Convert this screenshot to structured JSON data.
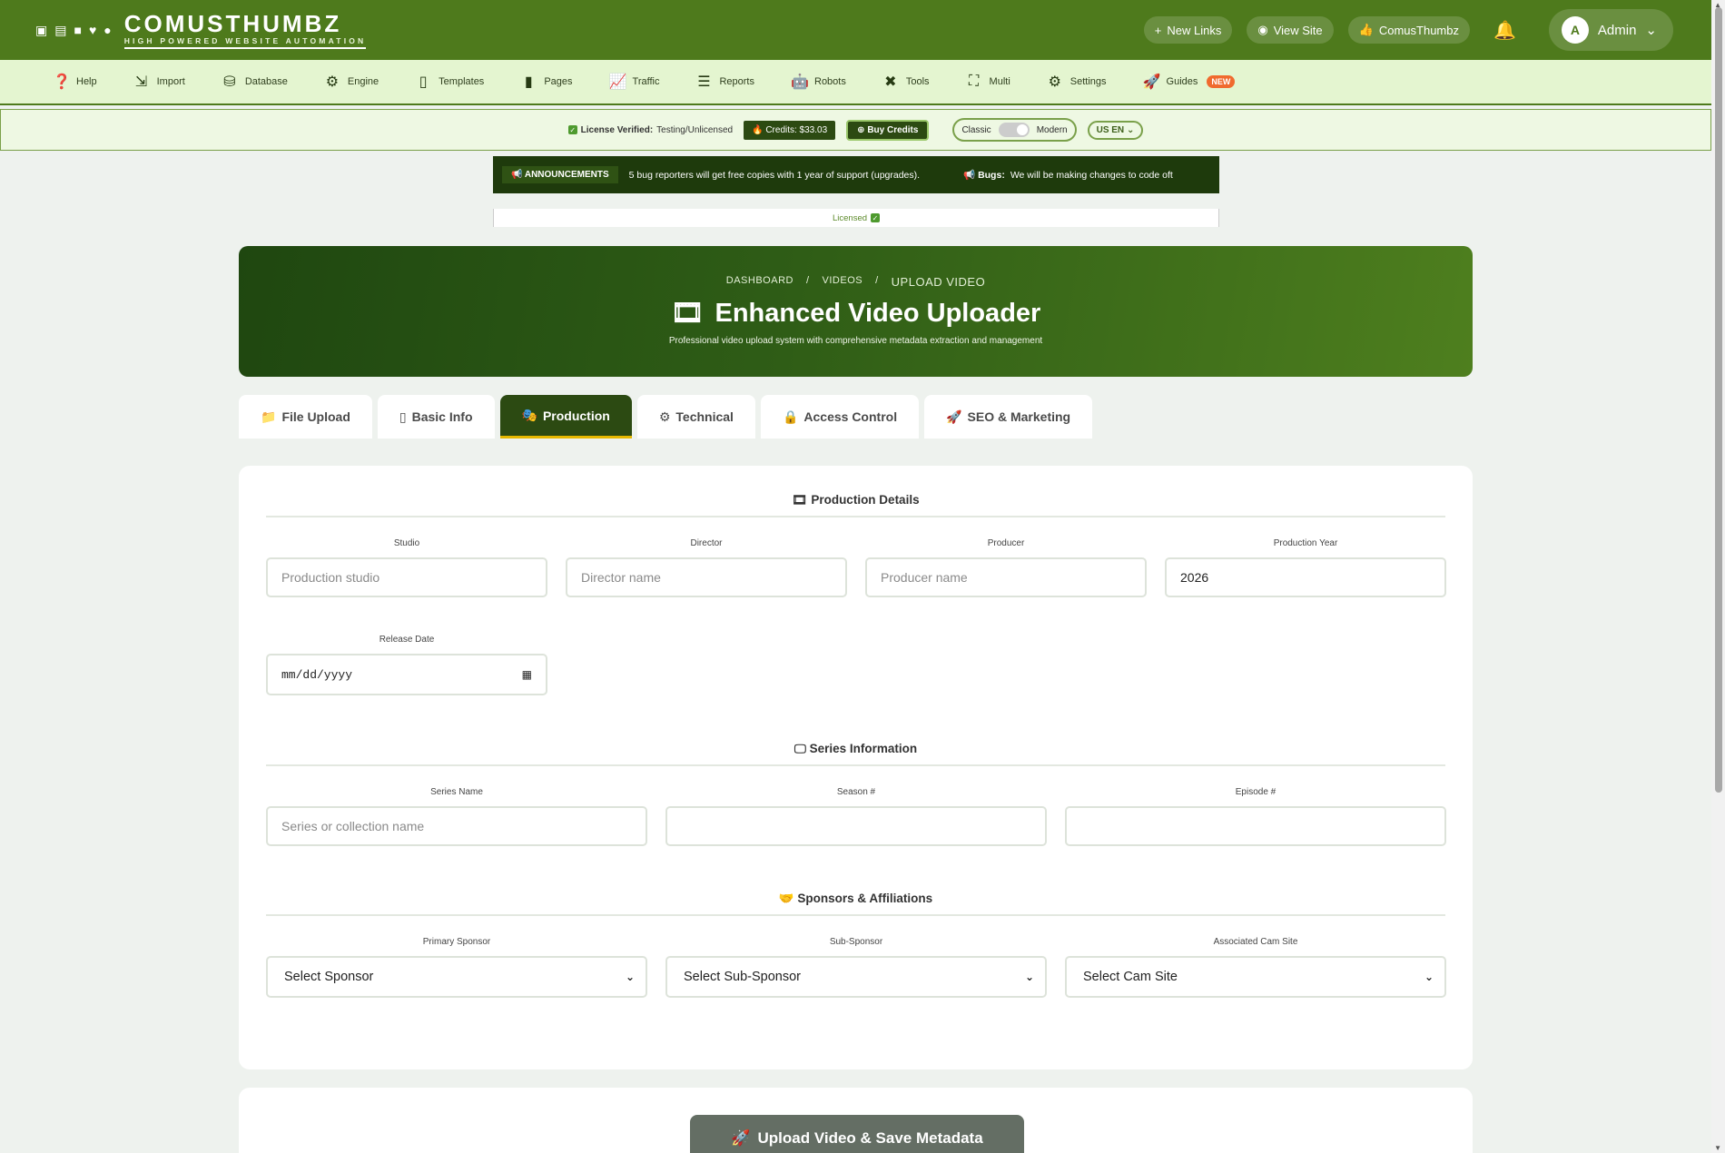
{
  "header": {
    "logo_title": "COMUSTHUMBZ",
    "logo_subtitle": "HIGH POWERED WEBSITE AUTOMATION",
    "new_links": "New Links",
    "view_site": "View Site",
    "brand_link": "ComusThumbz",
    "avatar_letter": "A",
    "user": "Admin"
  },
  "nav": {
    "items": [
      {
        "label": "Help",
        "icon": "help-icon"
      },
      {
        "label": "Import",
        "icon": "import-icon"
      },
      {
        "label": "Database",
        "icon": "database-icon"
      },
      {
        "label": "Engine",
        "icon": "gears-icon"
      },
      {
        "label": "Templates",
        "icon": "file-code-icon"
      },
      {
        "label": "Pages",
        "icon": "file-icon"
      },
      {
        "label": "Traffic",
        "icon": "chart-line-icon"
      },
      {
        "label": "Reports",
        "icon": "list-chart-icon"
      },
      {
        "label": "Robots",
        "icon": "robot-icon"
      },
      {
        "label": "Tools",
        "icon": "tools-icon"
      },
      {
        "label": "Multi",
        "icon": "sitemap-icon"
      },
      {
        "label": "Settings",
        "icon": "gear-icon"
      },
      {
        "label": "Guides",
        "icon": "rocket-icon"
      }
    ],
    "guides_badge": "NEW"
  },
  "license": {
    "verified_label": "License Verified:",
    "verified_value": "Testing/Unlicensed",
    "credits": "Credits: $33.03",
    "buy": "Buy Credits",
    "mode_classic": "Classic",
    "mode_modern": "Modern",
    "lang": "US EN"
  },
  "announcement": {
    "tag": "ANNOUNCEMENTS",
    "text": "5 bug reporters will get free copies with 1 year of support (upgrades).",
    "bugs_label": "Bugs:",
    "bugs_text": "We will be making changes to code oft"
  },
  "licensed_strip": "Licensed",
  "hero": {
    "crumb1": "DASHBOARD",
    "crumb2": "VIDEOS",
    "crumb3": "UPLOAD VIDEO",
    "title": "Enhanced Video Uploader",
    "subtitle": "Professional video upload system with comprehensive metadata extraction and management"
  },
  "tabs": [
    {
      "label": "File Upload"
    },
    {
      "label": "Basic Info"
    },
    {
      "label": "Production"
    },
    {
      "label": "Technical"
    },
    {
      "label": "Access Control"
    },
    {
      "label": "SEO & Marketing"
    }
  ],
  "production": {
    "title": "Production Details",
    "studio_label": "Studio",
    "studio_ph": "Production studio",
    "director_label": "Director",
    "director_ph": "Director name",
    "producer_label": "Producer",
    "producer_ph": "Producer name",
    "year_label": "Production Year",
    "year_value": "2026",
    "release_label": "Release Date",
    "release_value": "mm/dd/yyyy"
  },
  "series": {
    "title": "Series Information",
    "name_label": "Series Name",
    "name_ph": "Series or collection name",
    "season_label": "Season #",
    "episode_label": "Episode #"
  },
  "sponsors": {
    "title": "Sponsors & Affiliations",
    "primary_label": "Primary Sponsor",
    "primary_value": "Select Sponsor",
    "sub_label": "Sub-Sponsor",
    "sub_value": "Select Sub-Sponsor",
    "cam_label": "Associated Cam Site",
    "cam_value": "Select Cam Site"
  },
  "upload_button": "Upload Video & Save Metadata"
}
